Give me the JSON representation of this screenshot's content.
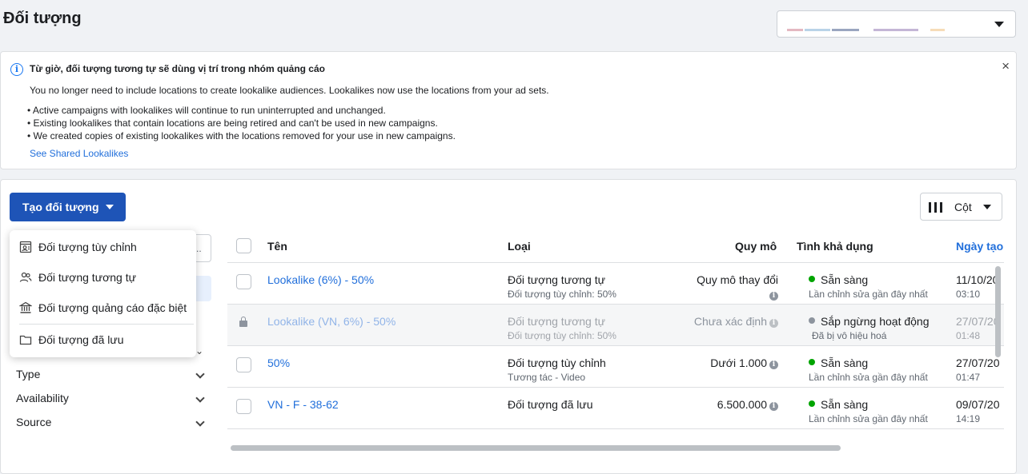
{
  "page": {
    "title": "Đối tượng"
  },
  "account_selector": {
    "bar_colors": [
      "#e4b8c1",
      "#b9d3e8",
      "#9aa6c0",
      "#c4b6d6",
      "#f6dcb8"
    ]
  },
  "notice": {
    "title": "Từ giờ, đối tượng tương tự sẽ dùng vị trí trong nhóm quảng cáo",
    "body": "You no longer need to include locations to create lookalike audiences. Lookalikes now use the locations from your ad sets.",
    "bullets": [
      "• Active campaigns with lookalikes will continue to run uninterrupted and unchanged.",
      "• Existing lookalikes that contain locations are being retired and can't be used in new campaigns.",
      "• We created copies of existing lookalikes with the locations removed for your use in new campaigns."
    ],
    "link": "See Shared Lookalikes",
    "close_icon": "×",
    "info_icon": "i"
  },
  "toolbar": {
    "create_label": "Tạo đối tượng",
    "columns_label": "Cột"
  },
  "create_menu": {
    "items": [
      {
        "label": "Đối tượng tùy chỉnh",
        "icon": "custom-audience-icon"
      },
      {
        "label": "Đối tượng tương tự",
        "icon": "people-icon"
      },
      {
        "label": "Đối tượng quảng cáo đặc biệt",
        "icon": "institution-icon"
      },
      {
        "label": "Đối tượng đã lưu",
        "icon": "folder-icon"
      }
    ]
  },
  "sidebar": {
    "search_text": "..",
    "filters": [
      "Type",
      "Availability",
      "Source"
    ]
  },
  "table": {
    "headers": {
      "name": "Tên",
      "type": "Loại",
      "size": "Quy mô",
      "availability": "Tình khả dụng",
      "date": "Ngày tạo"
    },
    "rows": [
      {
        "name": "Lookalike (6%) - 50%",
        "type": "Đối tượng tương tự",
        "subtype": "Đối tượng tùy chỉnh: 50%",
        "size": "Quy mô thay đổi",
        "status": "Sẵn sàng",
        "status_color": "#00a400",
        "status_detail": "Lần chỉnh sửa gần đây nhất",
        "date": "11/10/20",
        "time": "03:10"
      },
      {
        "name": "Lookalike (VN, 6%) - 50%",
        "type": "Đối tượng tương tự",
        "subtype": "Đối tượng tùy chỉnh: 50%",
        "size": "Chưa xác định",
        "status": "Sắp ngừng hoạt động",
        "status_color": "#8d949e",
        "status_detail": "Đã bị vô hiệu hoá",
        "date": "27/07/20",
        "time": "01:48"
      },
      {
        "name": "50%",
        "type": "Đối tượng tùy chỉnh",
        "subtype": "Tương tác - Video",
        "size": "Dưới 1.000",
        "status": "Sẵn sàng",
        "status_color": "#00a400",
        "status_detail": "Lần chỉnh sửa gần đây nhất",
        "date": "27/07/20",
        "time": "01:47"
      },
      {
        "name": "VN - F - 38-62",
        "type": "Đối tượng đã lưu",
        "subtype": "",
        "size": "6.500.000",
        "status": "Sẵn sàng",
        "status_color": "#00a400",
        "status_detail": "Lần chỉnh sửa gần đây nhất",
        "date": "09/07/20",
        "time": "14:19"
      }
    ]
  }
}
